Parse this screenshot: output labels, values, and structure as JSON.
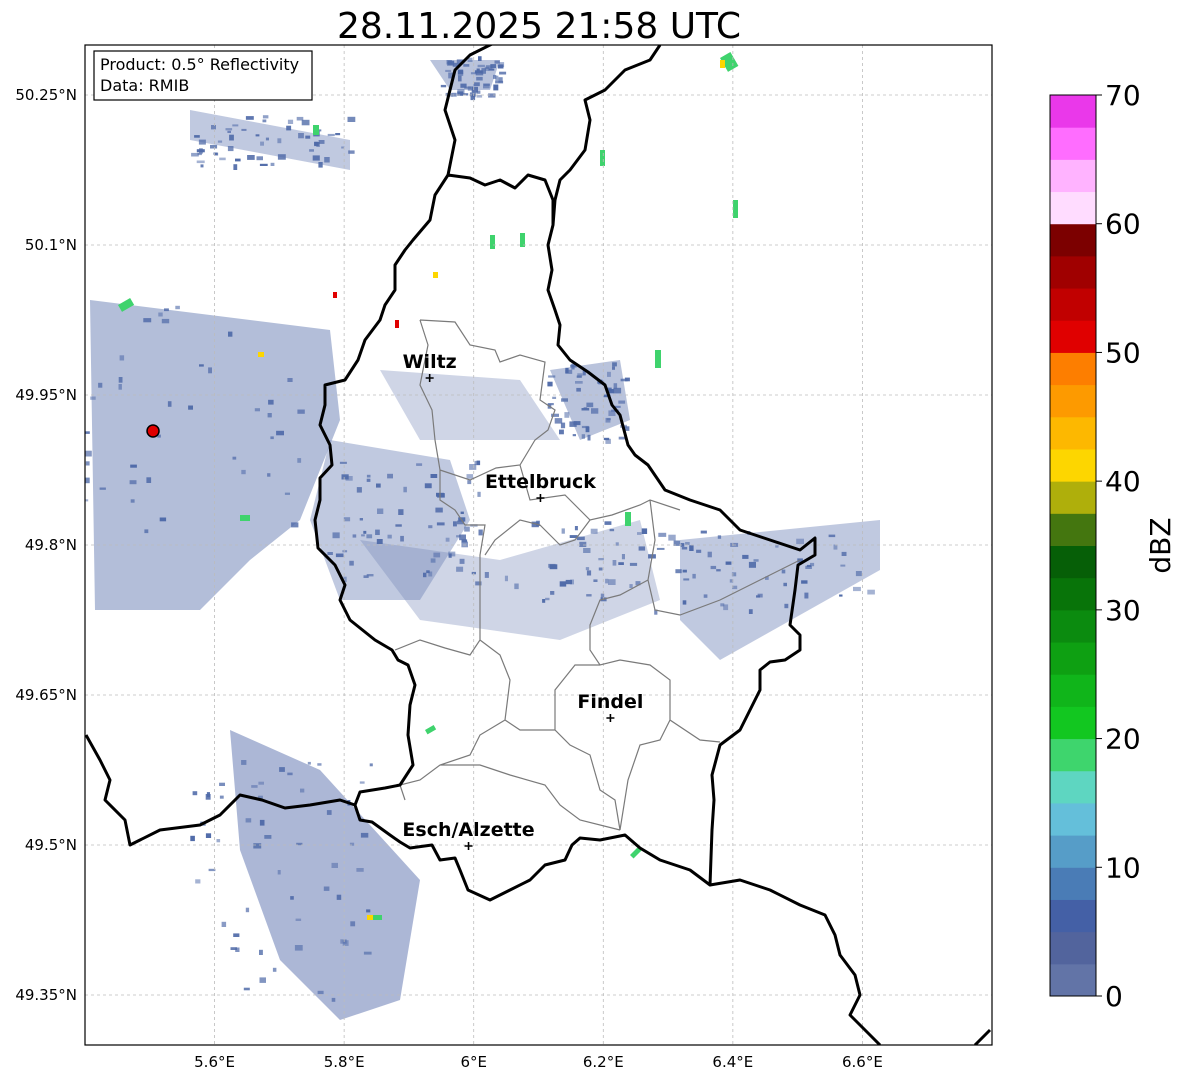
{
  "title": "28.11.2025 21:58 UTC",
  "info": {
    "product": "Product: 0.5° Reflectivity",
    "data_source": "Data: RMIB"
  },
  "map": {
    "lon_range": [
      5.4,
      6.8
    ],
    "lat_range": [
      49.3,
      50.3
    ],
    "lon_ticks": [
      {
        "value": 5.6,
        "label": "5.6°E"
      },
      {
        "value": 5.8,
        "label": "5.8°E"
      },
      {
        "value": 6.0,
        "label": "6°E"
      },
      {
        "value": 6.2,
        "label": "6.2°E"
      },
      {
        "value": 6.4,
        "label": "6.4°E"
      },
      {
        "value": 6.6,
        "label": "6.6°E"
      }
    ],
    "lat_ticks": [
      {
        "value": 50.25,
        "label": "50.25°N"
      },
      {
        "value": 50.1,
        "label": "50.1°N"
      },
      {
        "value": 49.95,
        "label": "49.95°N"
      },
      {
        "value": 49.8,
        "label": "49.8°N"
      },
      {
        "value": 49.65,
        "label": "49.65°N"
      },
      {
        "value": 49.5,
        "label": "49.5°N"
      },
      {
        "value": 49.35,
        "label": "49.35°N"
      }
    ],
    "radar_site": {
      "lon": 5.505,
      "lat": 49.914
    },
    "cities": [
      {
        "name": "Wiltz",
        "lon": 5.932,
        "lat": 49.967
      },
      {
        "name": "Ettelbruck",
        "lon": 6.103,
        "lat": 49.847
      },
      {
        "name": "Findel",
        "lon": 6.211,
        "lat": 49.627
      },
      {
        "name": "Esch/Alzette",
        "lon": 5.992,
        "lat": 49.499
      }
    ]
  },
  "colorbar": {
    "label": "dBZ",
    "min": 0,
    "max": 70,
    "ticks": [
      "0",
      "10",
      "20",
      "30",
      "40",
      "50",
      "60",
      "70"
    ],
    "colors": [
      "#6274a7",
      "#52649d",
      "#4460a6",
      "#4a7cb6",
      "#569dc8",
      "#64bfda",
      "#5ed6c1",
      "#3ed56d",
      "#12c720",
      "#10b51a",
      "#0ea012",
      "#0b8b0f",
      "#087409",
      "#065f07",
      "#44760f",
      "#afaf0b",
      "#fdd600",
      "#fdb800",
      "#fd9a00",
      "#fd7e00",
      "#e00000",
      "#c10000",
      "#a00000",
      "#7c0000",
      "#ffdcff",
      "#ffb3ff",
      "#ff6dff",
      "#ea38ea"
    ]
  }
}
